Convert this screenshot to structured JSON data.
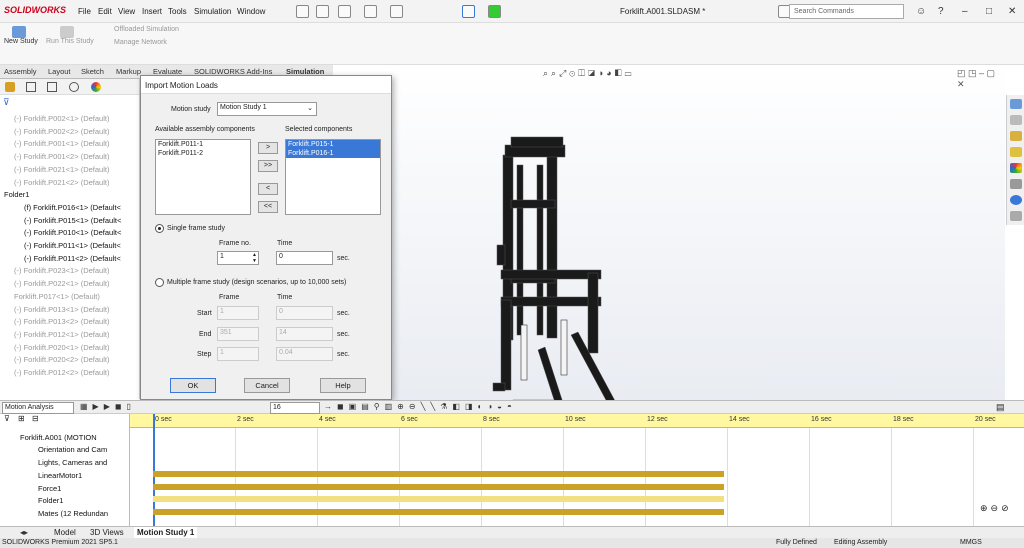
{
  "app": {
    "logo": "SOLIDWORKS",
    "menus": [
      "File",
      "Edit",
      "View",
      "Insert",
      "Tools",
      "Simulation",
      "Window"
    ],
    "doc_title": "Forklift.A001.SLDASM *",
    "search_placeholder": "Search Commands"
  },
  "cmd": {
    "new_study": "New Study",
    "run_study": "Run This Study",
    "offloaded": "Offloaded Simulation",
    "manage_network": "Manage Network"
  },
  "tabs": [
    "Assembly",
    "Layout",
    "Sketch",
    "Markup",
    "Evaluate",
    "SOLIDWORKS Add-Ins",
    "Simulation"
  ],
  "tree": [
    {
      "t": "(-) Forklift.P002<1> (Default)",
      "s": "dim"
    },
    {
      "t": "(-) Forklift.P002<2> (Default)",
      "s": "dim"
    },
    {
      "t": "(-) Forklift.P001<1> (Default)",
      "s": "dim"
    },
    {
      "t": "(-) Forklift.P001<2> (Default)",
      "s": "dim"
    },
    {
      "t": "(-) Forklift.P021<1> (Default)",
      "s": "dim"
    },
    {
      "t": "(-) Forklift.P021<2> (Default)",
      "s": "dim"
    },
    {
      "t": "Folder1",
      "s": "blk"
    },
    {
      "t": "(f) Forklift.P016<1> (Default<",
      "s": "blk"
    },
    {
      "t": "(-) Forklift.P015<1> (Default<",
      "s": "blk"
    },
    {
      "t": "(-) Forklift.P010<1> (Default<",
      "s": "blk"
    },
    {
      "t": "(-) Forklift.P011<1> (Default<",
      "s": "blk"
    },
    {
      "t": "(-) Forklift.P011<2> (Default<",
      "s": "blk"
    },
    {
      "t": "(-) Forklift.P023<1> (Default)",
      "s": "dim"
    },
    {
      "t": "(-) Forklift.P022<1> (Default)",
      "s": "dim"
    },
    {
      "t": "Forklift.P017<1> (Default)",
      "s": "dim"
    },
    {
      "t": "(-) Forklift.P013<1> (Default)",
      "s": "dim"
    },
    {
      "t": "(-) Forklift.P013<2> (Default)",
      "s": "dim"
    },
    {
      "t": "(-) Forklift.P012<1> (Default)",
      "s": "dim"
    },
    {
      "t": "(-) Forklift.P020<1> (Default)",
      "s": "dim"
    },
    {
      "t": "(-) Forklift.P020<2> (Default)",
      "s": "dim"
    },
    {
      "t": "(-) Forklift.P012<2> (Default)",
      "s": "dim"
    }
  ],
  "dialog": {
    "title": "Import Motion Loads",
    "motion_study_label": "Motion study",
    "motion_study_value": "Motion Study 1",
    "available_label": "Available assembly components",
    "selected_label": "Selected components",
    "available": [
      "Forklift.P011-1",
      "Forklift.P011-2"
    ],
    "selected": [
      "Forklift.P015-1",
      "Forklift.P016-1"
    ],
    "btn_add": ">",
    "btn_add_all": ">>",
    "btn_remove": "<",
    "btn_remove_all": "<<",
    "single_label": "Single frame study",
    "frame_no_label": "Frame no.",
    "frame_no_value": "1",
    "time_label": "Time",
    "time_value": "0",
    "sec": "sec.",
    "multi_label": "Multiple frame study (design scenarios, up to 10,000 sets)",
    "frame_col": "Frame",
    "time_col": "Time",
    "start_label": "Start",
    "start_frame": "1",
    "start_time": "0",
    "end_label": "End",
    "end_frame": "351",
    "end_time": "14",
    "step_label": "Step",
    "step_frame": "1",
    "step_time": "0.04",
    "ok": "OK",
    "cancel": "Cancel",
    "help": "Help"
  },
  "motion": {
    "analysis_type": "Motion Analysis",
    "frame_value": "16",
    "tree": [
      "Forklift.A001 (MOTION",
      "Orientation and Cam",
      "Lights, Cameras and",
      "LinearMotor1",
      "Force1",
      "Folder1",
      "Mates (12 Redundan"
    ],
    "ticks": [
      "0 sec",
      "2 sec",
      "4 sec",
      "6 sec",
      "8 sec",
      "10 sec",
      "12 sec",
      "14 sec",
      "16 sec",
      "18 sec",
      "20 sec"
    ]
  },
  "bottom_tabs": [
    "Model",
    "3D Views",
    "Motion Study 1"
  ],
  "status": {
    "version": "SOLIDWORKS Premium 2021 SP5.1",
    "defined": "Fully Defined",
    "mode": "Editing Assembly",
    "units": "MMGS"
  }
}
